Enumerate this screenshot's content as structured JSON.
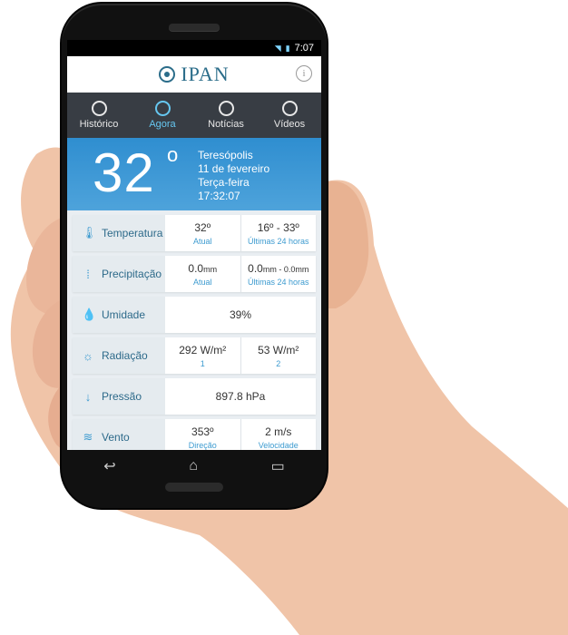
{
  "status_bar": {
    "time": "7:07",
    "wifi_icon": "wifi-icon",
    "signal_icon": "signal-icon",
    "battery_icon": "battery-icon"
  },
  "app": {
    "title": "IPAN",
    "info_icon": "info-icon"
  },
  "tabs": [
    {
      "label": "Histórico",
      "icon": "history-icon",
      "active": false
    },
    {
      "label": "Agora",
      "icon": "clock-icon",
      "active": true
    },
    {
      "label": "Notícias",
      "icon": "news-icon",
      "active": false
    },
    {
      "label": "Vídeos",
      "icon": "play-icon",
      "active": false
    }
  ],
  "current": {
    "temperature": "32",
    "degree": "o",
    "city": "Teresópolis",
    "date": "11 de fevereiro",
    "weekday": "Terça-feira",
    "time": "17:32:07"
  },
  "rows": {
    "temperatura": {
      "label": "Temperatura",
      "icon": "thermometer-icon",
      "v1": "32º",
      "s1": "Atual",
      "v2": "16º - 33º",
      "s2": "Últimas 24 horas"
    },
    "precipitacao": {
      "label": "Precipitação",
      "icon": "rain-icon",
      "v1": "0.0",
      "u1": "mm",
      "s1": "Atual",
      "v2a": "0.0",
      "v2b": "mm - 0.0",
      "v2c": "mm",
      "s2": "Últimas 24 horas"
    },
    "umidade": {
      "label": "Umidade",
      "icon": "drop-icon",
      "v1": "39%"
    },
    "radiacao": {
      "label": "Radiação",
      "icon": "sun-icon",
      "v1": "292 W/m²",
      "s1": "1",
      "v2": "53 W/m²",
      "s2": "2"
    },
    "pressao": {
      "label": "Pressão",
      "icon": "arrow-down-icon",
      "v1": "897.8 hPa"
    },
    "vento": {
      "label": "Vento",
      "icon": "wind-icon",
      "v1": "353º",
      "s1": "Direção",
      "v2": "2 m/s",
      "s2": "Velocidade"
    }
  },
  "nav": {
    "back_icon": "back-icon",
    "home_icon": "home-icon",
    "recents_icon": "recents-icon"
  }
}
